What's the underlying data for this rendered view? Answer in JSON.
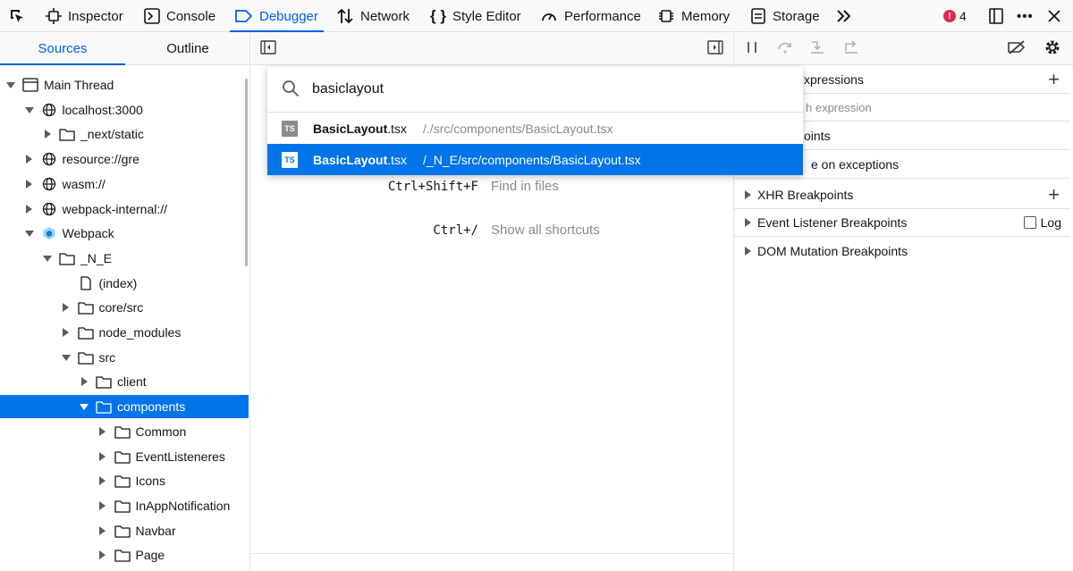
{
  "toolbar": {
    "tabs": [
      {
        "label": "Inspector",
        "icon": "inspector-icon"
      },
      {
        "label": "Console",
        "icon": "console-icon"
      },
      {
        "label": "Debugger",
        "icon": "debugger-icon",
        "active": true
      },
      {
        "label": "Network",
        "icon": "network-icon"
      },
      {
        "label": "Style Editor",
        "icon": "style-editor-icon"
      },
      {
        "label": "Performance",
        "icon": "performance-icon"
      },
      {
        "label": "Memory",
        "icon": "memory-icon"
      },
      {
        "label": "Storage",
        "icon": "storage-icon"
      }
    ],
    "error_count": "4",
    "accent_color": "#0061e0"
  },
  "sources": {
    "tabs": [
      "Sources",
      "Outline"
    ],
    "tree": [
      {
        "label": "Main Thread",
        "depth": 0,
        "toggle": "open",
        "icon": "window-icon"
      },
      {
        "label": "localhost:3000",
        "depth": 1,
        "toggle": "open",
        "icon": "globe-icon"
      },
      {
        "label": "_next/static",
        "depth": 2,
        "toggle": "closed",
        "icon": "folder-icon"
      },
      {
        "label": "resource://gre",
        "depth": 1,
        "toggle": "closed",
        "icon": "globe-icon"
      },
      {
        "label": "wasm://",
        "depth": 1,
        "toggle": "closed",
        "icon": "globe-icon"
      },
      {
        "label": "webpack-internal://",
        "depth": 1,
        "toggle": "closed",
        "icon": "globe-icon"
      },
      {
        "label": "Webpack",
        "depth": 1,
        "toggle": "open",
        "icon": "webpack-icon"
      },
      {
        "label": "_N_E",
        "depth": 2,
        "toggle": "open",
        "icon": "folder-icon"
      },
      {
        "label": "(index)",
        "depth": 3,
        "toggle": "none",
        "icon": "file-icon"
      },
      {
        "label": "core/src",
        "depth": 3,
        "toggle": "closed",
        "icon": "folder-icon"
      },
      {
        "label": "node_modules",
        "depth": 3,
        "toggle": "closed",
        "icon": "folder-icon"
      },
      {
        "label": "src",
        "depth": 3,
        "toggle": "open",
        "icon": "folder-icon"
      },
      {
        "label": "client",
        "depth": 4,
        "toggle": "closed",
        "icon": "folder-icon"
      },
      {
        "label": "components",
        "depth": 4,
        "toggle": "open",
        "icon": "folder-icon",
        "selected": true
      },
      {
        "label": "Common",
        "depth": 5,
        "toggle": "closed",
        "icon": "folder-icon"
      },
      {
        "label": "EventListeneres",
        "depth": 5,
        "toggle": "closed",
        "icon": "folder-icon"
      },
      {
        "label": "Icons",
        "depth": 5,
        "toggle": "closed",
        "icon": "folder-icon"
      },
      {
        "label": "InAppNotification",
        "depth": 5,
        "toggle": "closed",
        "icon": "folder-icon"
      },
      {
        "label": "Navbar",
        "depth": 5,
        "toggle": "closed",
        "icon": "folder-icon"
      },
      {
        "label": "Page",
        "depth": 5,
        "toggle": "closed",
        "icon": "folder-icon"
      }
    ]
  },
  "editor": {
    "shortcuts": [
      {
        "keys": "Ctrl+Shift+F",
        "label": "Find in files"
      },
      {
        "keys": "Ctrl+/",
        "label": "Show all shortcuts"
      }
    ]
  },
  "quick_open": {
    "query": "basiclayout",
    "results": [
      {
        "badge": "TS",
        "name_bold": "BasicLayout",
        "name_rest": ".tsx",
        "path": "/./src/components/BasicLayout.tsx"
      },
      {
        "badge": "TS",
        "name_bold": "BasicLayout",
        "name_rest": ".tsx",
        "path": "/_N_E/src/components/BasicLayout.tsx",
        "selected": true
      }
    ]
  },
  "right_panel": {
    "watch_title_visible": "xpressions",
    "watch_placeholder_visible": "h expression",
    "breakpoints_title_visible": "oints",
    "exceptions_visible": "e on exceptions",
    "sections": [
      "XHR Breakpoints",
      "Event Listener Breakpoints",
      "DOM Mutation Breakpoints"
    ],
    "log_label": "Log"
  }
}
